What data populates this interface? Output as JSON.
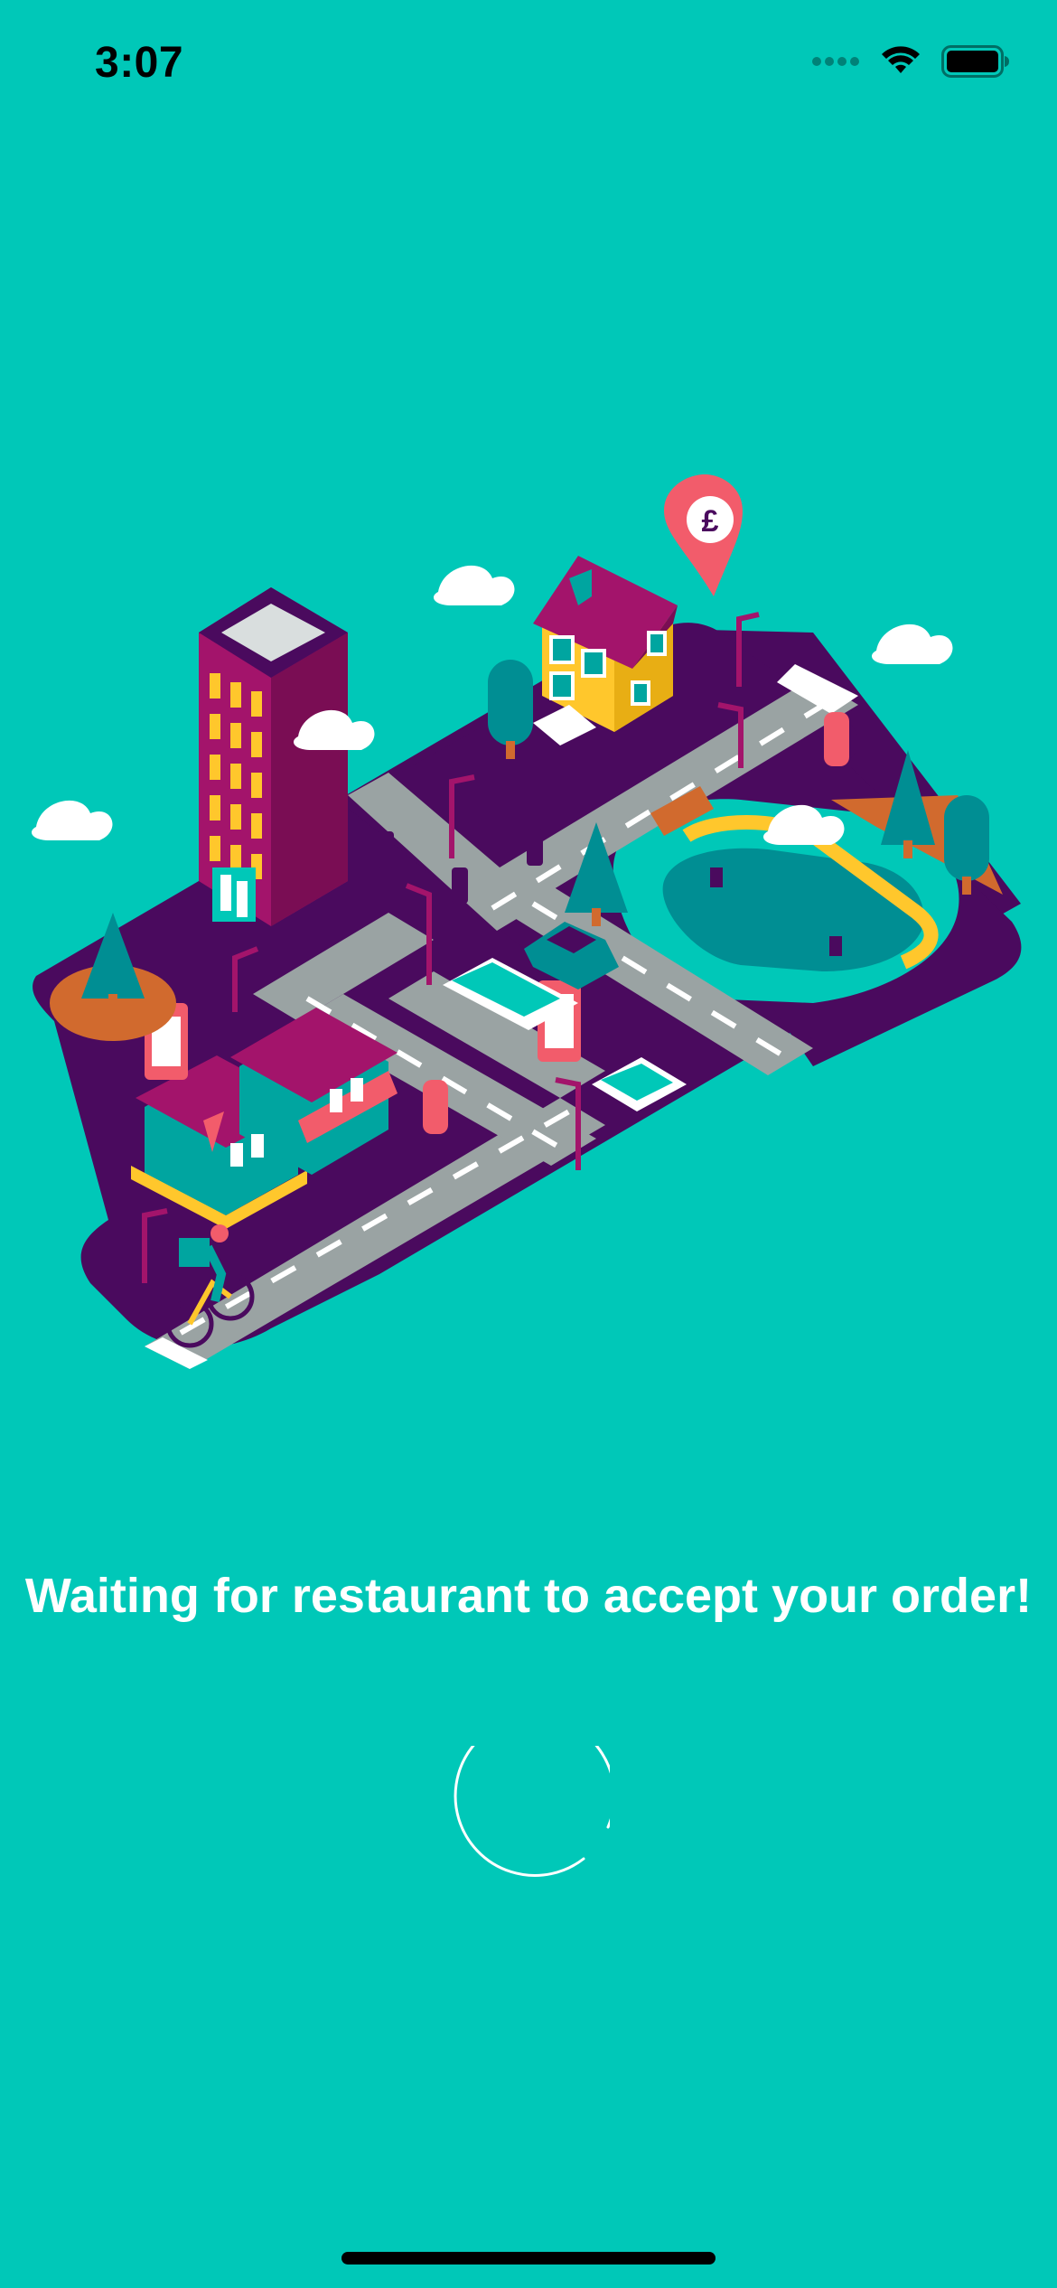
{
  "status_bar": {
    "time": "3:07",
    "icons": [
      "signal-dots-icon",
      "wifi-icon",
      "battery-icon"
    ]
  },
  "illustration": {
    "icon": "isometric-city-delivery-illustration",
    "map_pin_symbol": "£"
  },
  "message": {
    "text": "Waiting for restaurant to accept your order!"
  },
  "spinner": {
    "icon": "loading-spinner-icon"
  },
  "colors": {
    "background": "#00C8B8",
    "purple": "#4A0A5E",
    "magenta": "#A3146B",
    "yellow": "#FFC72C",
    "coral": "#F25C6B",
    "road": "#9AA3A3"
  }
}
